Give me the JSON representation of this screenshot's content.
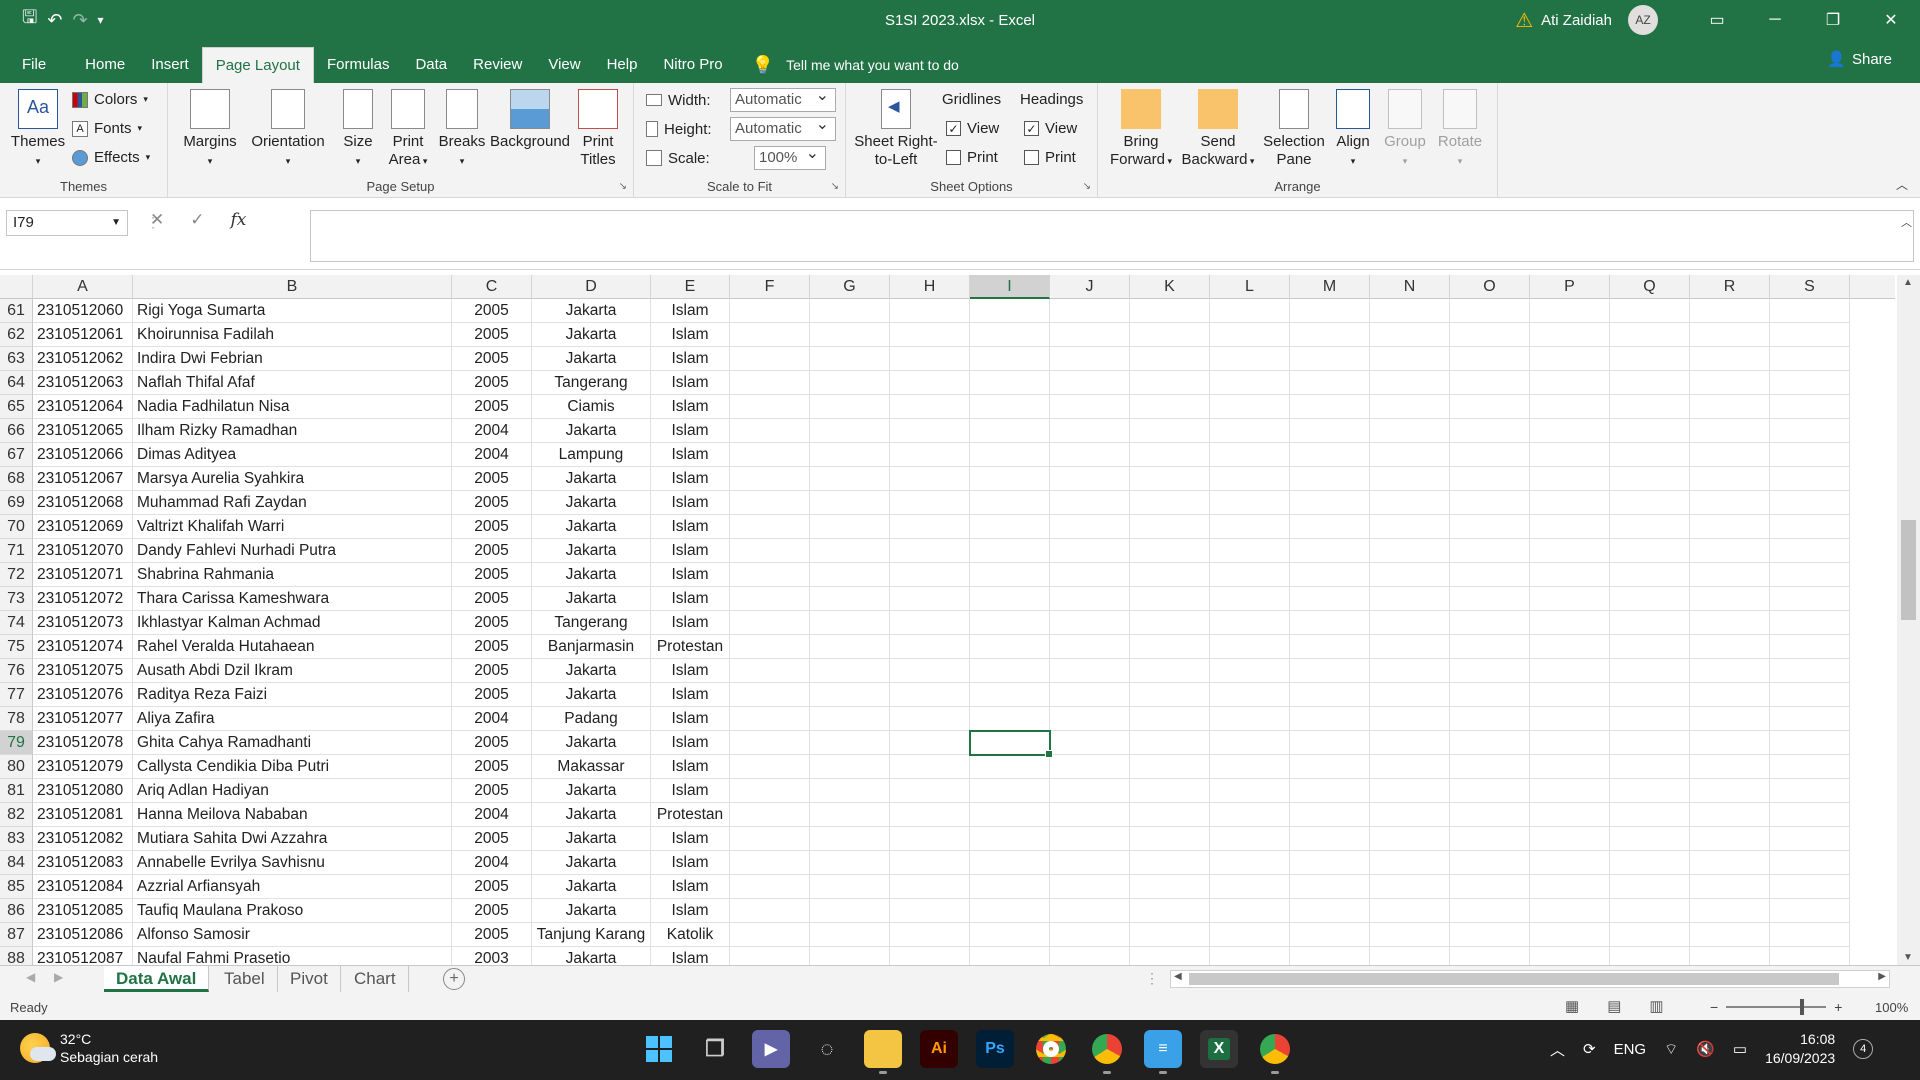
{
  "window": {
    "title": "S1SI 2023.xlsx  -  Excel",
    "user_name": "Ati Zaidiah",
    "user_initials": "AZ"
  },
  "menu": {
    "tabs": [
      "File",
      "Home",
      "Insert",
      "Page Layout",
      "Formulas",
      "Data",
      "Review",
      "View",
      "Help",
      "Nitro Pro"
    ],
    "active_tab": "Page Layout",
    "tell_me": "Tell me what you want to do",
    "share": "Share"
  },
  "ribbon": {
    "themes": {
      "label": "Themes",
      "colors": "Colors",
      "fonts": "Fonts",
      "effects": "Effects",
      "group": "Themes"
    },
    "page_setup": {
      "margins": "Margins",
      "orientation": "Orientation",
      "size": "Size",
      "print_area_1": "Print",
      "print_area_2": "Area",
      "breaks": "Breaks",
      "background": "Background",
      "print_titles_1": "Print",
      "print_titles_2": "Titles",
      "group": "Page Setup"
    },
    "scale": {
      "width_label": "Width:",
      "width_value": "Automatic",
      "height_label": "Height:",
      "height_value": "Automatic",
      "scale_label": "Scale:",
      "scale_value": "100%",
      "group": "Scale to Fit"
    },
    "sheet_options": {
      "rtl_1": "Sheet Right-",
      "rtl_2": "to-Left",
      "gridlines": "Gridlines",
      "headings": "Headings",
      "view": "View",
      "print": "Print",
      "group": "Sheet Options"
    },
    "arrange": {
      "bring_1": "Bring",
      "bring_2": "Forward",
      "send_1": "Send",
      "send_2": "Backward",
      "sel_1": "Selection",
      "sel_2": "Pane",
      "align": "Align",
      "group_btn": "Group",
      "rotate": "Rotate",
      "group": "Arrange"
    }
  },
  "formula_bar": {
    "name_box": "I79",
    "fx": "fx",
    "cancel": "✕",
    "enter": "✓",
    "content": ""
  },
  "columns": [
    "A",
    "B",
    "C",
    "D",
    "E",
    "F",
    "G",
    "H",
    "I",
    "J",
    "K",
    "L",
    "M",
    "N",
    "O",
    "P",
    "Q",
    "R",
    "S"
  ],
  "selected_column": "I",
  "selected_row": 79,
  "rows": [
    {
      "n": 61,
      "id": "2310512060",
      "name": "Rigi Yoga Sumarta",
      "year": "2005",
      "city": "Jakarta",
      "religion": "Islam"
    },
    {
      "n": 62,
      "id": "2310512061",
      "name": "Khoirunnisa Fadilah",
      "year": "2005",
      "city": "Jakarta",
      "religion": "Islam"
    },
    {
      "n": 63,
      "id": "2310512062",
      "name": "Indira Dwi Febrian",
      "year": "2005",
      "city": "Jakarta",
      "religion": "Islam"
    },
    {
      "n": 64,
      "id": "2310512063",
      "name": "Naflah Thifal Afaf",
      "year": "2005",
      "city": "Tangerang",
      "religion": "Islam"
    },
    {
      "n": 65,
      "id": "2310512064",
      "name": "Nadia Fadhilatun Nisa",
      "year": "2005",
      "city": "Ciamis",
      "religion": "Islam"
    },
    {
      "n": 66,
      "id": "2310512065",
      "name": "Ilham Rizky Ramadhan",
      "year": "2004",
      "city": "Jakarta",
      "religion": "Islam"
    },
    {
      "n": 67,
      "id": "2310512066",
      "name": "Dimas Adityea",
      "year": "2004",
      "city": "Lampung",
      "religion": "Islam"
    },
    {
      "n": 68,
      "id": "2310512067",
      "name": "Marsya Aurelia Syahkira",
      "year": "2005",
      "city": "Jakarta",
      "religion": "Islam"
    },
    {
      "n": 69,
      "id": "2310512068",
      "name": "Muhammad Rafi Zaydan",
      "year": "2005",
      "city": "Jakarta",
      "religion": "Islam"
    },
    {
      "n": 70,
      "id": "2310512069",
      "name": "Valtrizt Khalifah Warri",
      "year": "2005",
      "city": "Jakarta",
      "religion": "Islam"
    },
    {
      "n": 71,
      "id": "2310512070",
      "name": "Dandy Fahlevi Nurhadi Putra",
      "year": "2005",
      "city": "Jakarta",
      "religion": "Islam"
    },
    {
      "n": 72,
      "id": "2310512071",
      "name": "Shabrina Rahmania",
      "year": "2005",
      "city": "Jakarta",
      "religion": "Islam"
    },
    {
      "n": 73,
      "id": "2310512072",
      "name": "Thara Carissa Kameshwara",
      "year": "2005",
      "city": "Jakarta",
      "religion": "Islam"
    },
    {
      "n": 74,
      "id": "2310512073",
      "name": "Ikhlastyar Kalman Achmad",
      "year": "2005",
      "city": "Tangerang",
      "religion": "Islam"
    },
    {
      "n": 75,
      "id": "2310512074",
      "name": "Rahel Veralda Hutahaean",
      "year": "2005",
      "city": "Banjarmasin",
      "religion": "Protestan"
    },
    {
      "n": 76,
      "id": "2310512075",
      "name": "Ausath Abdi Dzil Ikram",
      "year": "2005",
      "city": "Jakarta",
      "religion": "Islam"
    },
    {
      "n": 77,
      "id": "2310512076",
      "name": "Raditya Reza Faizi",
      "year": "2005",
      "city": "Jakarta",
      "religion": "Islam"
    },
    {
      "n": 78,
      "id": "2310512077",
      "name": "Aliya Zafira",
      "year": "2004",
      "city": "Padang",
      "religion": "Islam"
    },
    {
      "n": 79,
      "id": "2310512078",
      "name": "Ghita Cahya Ramadhanti",
      "year": "2005",
      "city": "Jakarta",
      "religion": "Islam"
    },
    {
      "n": 80,
      "id": "2310512079",
      "name": "Callysta Cendikia Diba Putri",
      "year": "2005",
      "city": "Makassar",
      "religion": "Islam"
    },
    {
      "n": 81,
      "id": "2310512080",
      "name": "Ariq Adlan Hadiyan",
      "year": "2005",
      "city": "Jakarta",
      "religion": "Islam"
    },
    {
      "n": 82,
      "id": "2310512081",
      "name": "Hanna Meilova Nababan",
      "year": "2004",
      "city": "Jakarta",
      "religion": "Protestan"
    },
    {
      "n": 83,
      "id": "2310512082",
      "name": "Mutiara Sahita Dwi Azzahra",
      "year": "2005",
      "city": "Jakarta",
      "religion": "Islam"
    },
    {
      "n": 84,
      "id": "2310512083",
      "name": "Annabelle Evrilya Savhisnu",
      "year": "2004",
      "city": "Jakarta",
      "religion": "Islam"
    },
    {
      "n": 85,
      "id": "2310512084",
      "name": "Azzrial Arfiansyah",
      "year": "2005",
      "city": "Jakarta",
      "religion": "Islam"
    },
    {
      "n": 86,
      "id": "2310512085",
      "name": "Taufiq Maulana Prakoso",
      "year": "2005",
      "city": "Jakarta",
      "religion": "Islam"
    },
    {
      "n": 87,
      "id": "2310512086",
      "name": "Alfonso Samosir",
      "year": "2005",
      "city": "Tanjung Karang",
      "religion": "Katolik"
    },
    {
      "n": 88,
      "id": "2310512087",
      "name": "Naufal Fahmi Prasetio",
      "year": "2003",
      "city": "Jakarta",
      "religion": "Islam"
    }
  ],
  "sheets": [
    "Data Awal",
    "Tabel",
    "Pivot",
    "Chart"
  ],
  "active_sheet": "Data Awal",
  "status": {
    "text": "Ready",
    "zoom": "100%"
  },
  "taskbar": {
    "temp": "32°C",
    "weather": "Sebagian cerah",
    "lang": "ENG",
    "time": "16:08",
    "date": "16/09/2023",
    "notifications": "4"
  },
  "colors": {
    "accent": "#217346"
  }
}
